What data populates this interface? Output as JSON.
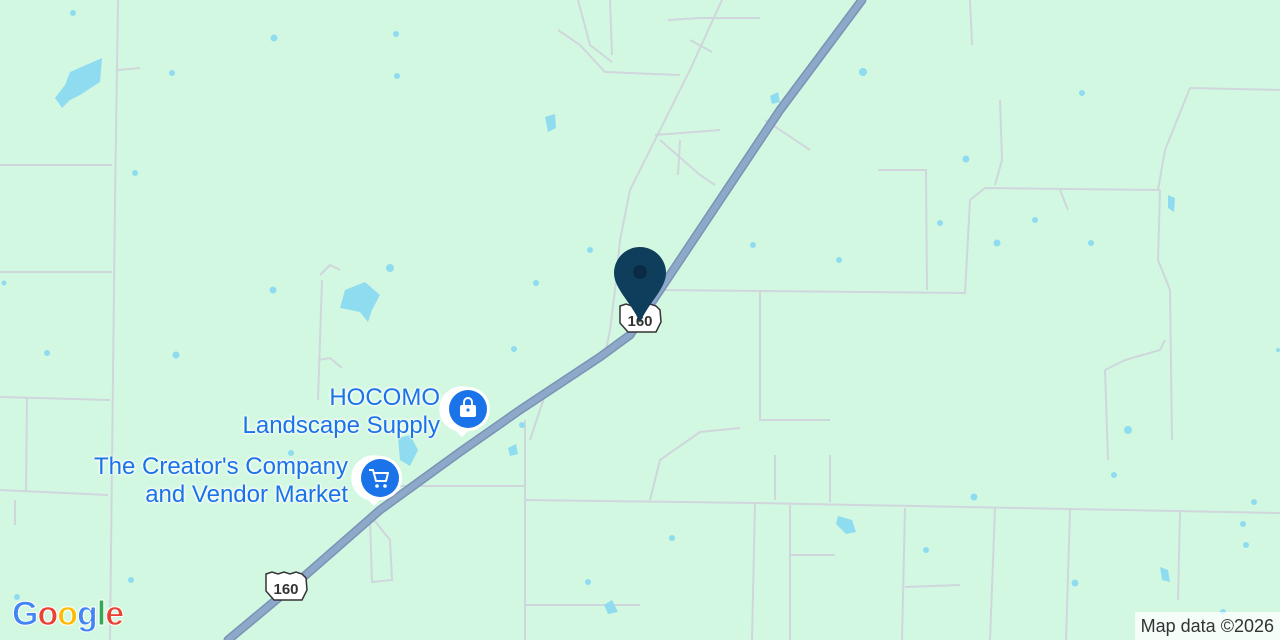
{
  "map": {
    "highway_shield": "160",
    "colors": {
      "land": "#d3f8e2",
      "water": "#8fdcf0",
      "minor_road": "#cfd6dc",
      "highway": "#8ea8c9",
      "highway_outline": "#7a93b6",
      "poi": "#1a73e8",
      "marker": "#0f3d5c"
    },
    "pois": [
      {
        "line1": "HOCOMO",
        "line2": "Landscape Supply",
        "icon": "shopping-bag-icon"
      },
      {
        "line1": "The Creator's Company",
        "line2": "and Vendor Market",
        "icon": "shopping-cart-icon"
      }
    ],
    "marker": {
      "icon": "location-pin-icon"
    }
  },
  "attribution": "Map data ©2026",
  "logo": {
    "letters": [
      "G",
      "o",
      "o",
      "g",
      "l",
      "e"
    ],
    "colors": [
      "#4285F4",
      "#EA4335",
      "#FBBC05",
      "#4285F4",
      "#34A853",
      "#EA4335"
    ]
  }
}
